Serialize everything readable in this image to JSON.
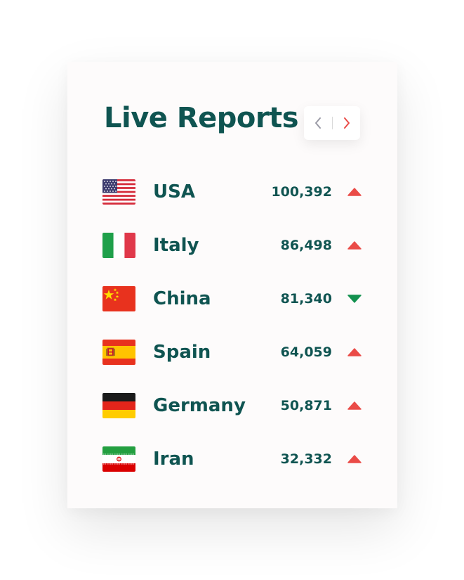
{
  "widget": {
    "title": "Live Reports",
    "nav": {
      "prev_icon": "chevron-left-icon",
      "next_icon": "chevron-right-icon"
    }
  },
  "colors": {
    "text": "#0f5451",
    "up": "#ea4b47",
    "down": "#13914f",
    "card": "#fdfbfb"
  },
  "reports": [
    {
      "country": "USA",
      "count": "100,392",
      "trend": "up",
      "flag": "usa-flag-icon"
    },
    {
      "country": "Italy",
      "count": "86,498",
      "trend": "up",
      "flag": "italy-flag-icon"
    },
    {
      "country": "China",
      "count": "81,340",
      "trend": "down",
      "flag": "china-flag-icon"
    },
    {
      "country": "Spain",
      "count": "64,059",
      "trend": "up",
      "flag": "spain-flag-icon"
    },
    {
      "country": "Germany",
      "count": "50,871",
      "trend": "up",
      "flag": "germany-flag-icon"
    },
    {
      "country": "Iran",
      "count": "32,332",
      "trend": "up",
      "flag": "iran-flag-icon"
    }
  ]
}
